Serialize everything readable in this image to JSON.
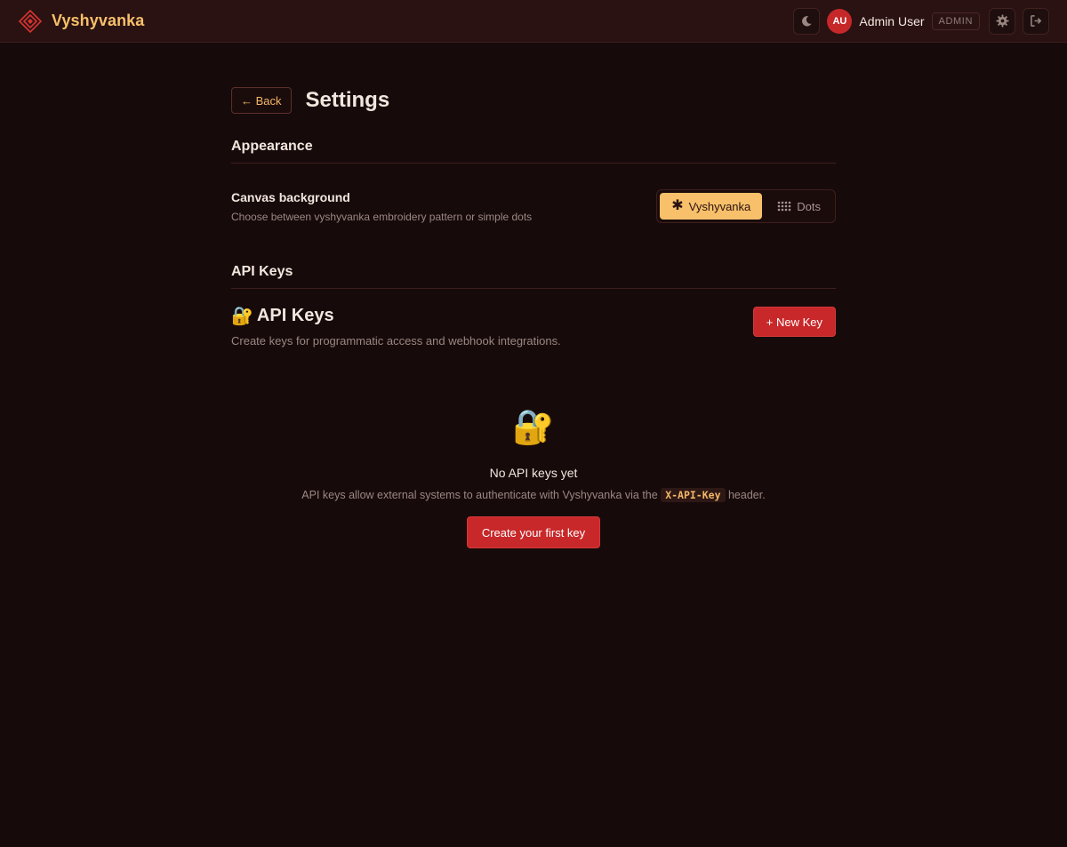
{
  "app": {
    "name": "Vyshyvanka",
    "accent": "#f8c06a",
    "background": "#170a0a",
    "danger": "#c8282a"
  },
  "topbar": {
    "theme_icon": "moon-icon",
    "avatar_initials": "AU",
    "user_name": "Admin User",
    "role": "ADMIN",
    "settings_icon": "gear-icon",
    "logout_icon": "logout-icon"
  },
  "page": {
    "back_label": "← Back",
    "title": "Settings"
  },
  "appearance": {
    "section_title": "Appearance",
    "canvas_label": "Canvas background",
    "canvas_desc": "Choose between vyshyvanka embroidery pattern or simple dots",
    "options": [
      {
        "icon": "asterisk-icon",
        "label": "Vyshyvanka",
        "active": true
      },
      {
        "icon": "dots-grid-icon",
        "label": "Dots",
        "active": false
      }
    ]
  },
  "api_keys": {
    "section_title": "API Keys",
    "card_icon": "🔐",
    "card_title": "API Keys",
    "card_desc": "Create keys for programmatic access and webhook integrations.",
    "new_key_label": "+ New Key",
    "empty": {
      "icon": "🔐",
      "title": "No API keys yet",
      "desc_before": "API keys allow external systems to authenticate with Vyshyvanka via the",
      "code": "X-API-Key",
      "desc_after": "header.",
      "button_label": "Create your first key"
    }
  }
}
